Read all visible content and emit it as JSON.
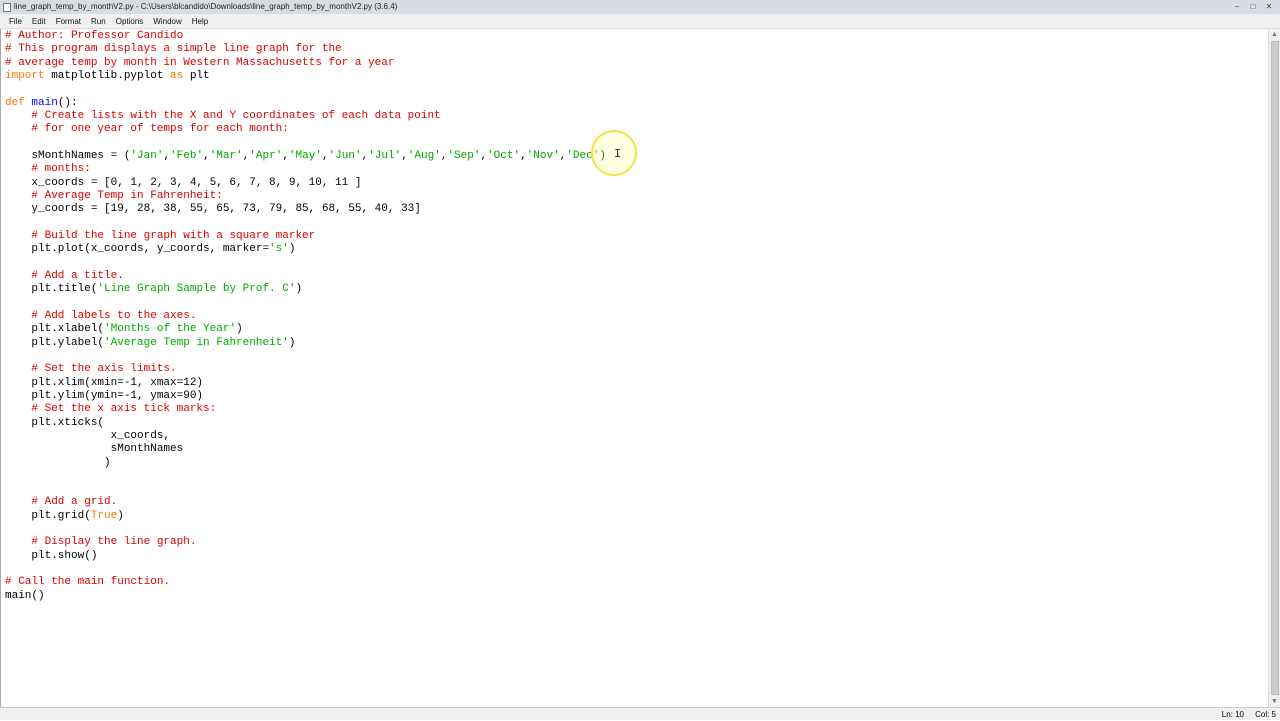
{
  "window": {
    "title": "line_graph_temp_by_monthV2.py - C:\\Users\\blcandido\\Downloads\\line_graph_temp_by_monthV2.py (3.6.4)",
    "minimize": "–",
    "maximize": "□",
    "close": "✕"
  },
  "menu": [
    "File",
    "Edit",
    "Format",
    "Run",
    "Options",
    "Window",
    "Help"
  ],
  "status": {
    "line": "Ln: 10",
    "col": "Col: 5"
  },
  "code": [
    [
      [
        "comment",
        "# Author: Professor Candido"
      ]
    ],
    [
      [
        "comment",
        "# This program displays a simple line graph for the"
      ]
    ],
    [
      [
        "comment",
        "# average temp by month in Western Massachusetts for a year"
      ]
    ],
    [
      [
        "keyword",
        "import"
      ],
      [
        "plain",
        " matplotlib.pyplot "
      ],
      [
        "keyword",
        "as"
      ],
      [
        "plain",
        " plt"
      ]
    ],
    [],
    [
      [
        "keyword",
        "def"
      ],
      [
        "plain",
        " "
      ],
      [
        "defname",
        "main"
      ],
      [
        "plain",
        "():"
      ]
    ],
    [
      [
        "plain",
        "    "
      ],
      [
        "comment",
        "# Create lists with the X and Y coordinates of each data point"
      ]
    ],
    [
      [
        "plain",
        "    "
      ],
      [
        "comment",
        "# for one year of temps for each month:"
      ]
    ],
    [],
    [
      [
        "plain",
        "    sMonthNames = ("
      ],
      [
        "string",
        "'Jan'"
      ],
      [
        "plain",
        ","
      ],
      [
        "string",
        "'Feb'"
      ],
      [
        "plain",
        ","
      ],
      [
        "string",
        "'Mar'"
      ],
      [
        "plain",
        ","
      ],
      [
        "string",
        "'Apr'"
      ],
      [
        "plain",
        ","
      ],
      [
        "string",
        "'May'"
      ],
      [
        "plain",
        ","
      ],
      [
        "string",
        "'Jun'"
      ],
      [
        "plain",
        ","
      ],
      [
        "string",
        "'Jul'"
      ],
      [
        "plain",
        ","
      ],
      [
        "string",
        "'Aug'"
      ],
      [
        "plain",
        ","
      ],
      [
        "string",
        "'Sep'"
      ],
      [
        "plain",
        ","
      ],
      [
        "string",
        "'Oct'"
      ],
      [
        "plain",
        ","
      ],
      [
        "string",
        "'Nov'"
      ],
      [
        "plain",
        ","
      ],
      [
        "string",
        "'Dec'"
      ],
      [
        "plain",
        ")"
      ]
    ],
    [
      [
        "plain",
        "    "
      ],
      [
        "comment",
        "# months:"
      ]
    ],
    [
      [
        "plain",
        "    x_coords = [0, 1, 2, 3, 4, 5, 6, 7, 8, 9, 10, 11 ]"
      ]
    ],
    [
      [
        "plain",
        "    "
      ],
      [
        "comment",
        "# Average Temp in Fahrenheit:"
      ]
    ],
    [
      [
        "plain",
        "    y_coords = [19, 28, 38, 55, 65, 73, 79, 85, 68, 55, 40, 33]"
      ]
    ],
    [],
    [
      [
        "plain",
        "    "
      ],
      [
        "comment",
        "# Build the line graph with a square marker"
      ]
    ],
    [
      [
        "plain",
        "    plt.plot(x_coords, y_coords, marker="
      ],
      [
        "string",
        "'s'"
      ],
      [
        "plain",
        ")"
      ]
    ],
    [],
    [
      [
        "plain",
        "    "
      ],
      [
        "comment",
        "# Add a title."
      ]
    ],
    [
      [
        "plain",
        "    plt.title("
      ],
      [
        "string",
        "'Line Graph Sample by Prof. C'"
      ],
      [
        "plain",
        ")"
      ]
    ],
    [],
    [
      [
        "plain",
        "    "
      ],
      [
        "comment",
        "# Add labels to the axes."
      ]
    ],
    [
      [
        "plain",
        "    plt.xlabel("
      ],
      [
        "string",
        "'Months of the Year'"
      ],
      [
        "plain",
        ")"
      ]
    ],
    [
      [
        "plain",
        "    plt.ylabel("
      ],
      [
        "string",
        "'Average Temp in Fahrenheit'"
      ],
      [
        "plain",
        ")"
      ]
    ],
    [],
    [
      [
        "plain",
        "    "
      ],
      [
        "comment",
        "# Set the axis limits."
      ]
    ],
    [
      [
        "plain",
        "    plt.xlim(xmin=-1, xmax=12)"
      ]
    ],
    [
      [
        "plain",
        "    plt.ylim(ymin=-1, ymax=90)"
      ]
    ],
    [
      [
        "plain",
        "    "
      ],
      [
        "comment",
        "# Set the x axis tick marks:"
      ]
    ],
    [
      [
        "plain",
        "    plt.xticks("
      ]
    ],
    [
      [
        "plain",
        "                x_coords,"
      ]
    ],
    [
      [
        "plain",
        "                sMonthNames"
      ]
    ],
    [
      [
        "plain",
        "               )"
      ]
    ],
    [],
    [],
    [
      [
        "plain",
        "    "
      ],
      [
        "comment",
        "# Add a grid."
      ]
    ],
    [
      [
        "plain",
        "    plt.grid("
      ],
      [
        "keyword",
        "True"
      ],
      [
        "plain",
        ")"
      ]
    ],
    [],
    [
      [
        "plain",
        "    "
      ],
      [
        "comment",
        "# Display the line graph."
      ]
    ],
    [
      [
        "plain",
        "    plt.show()"
      ]
    ],
    [],
    [
      [
        "comment",
        "# Call the main function."
      ]
    ],
    [
      [
        "plain",
        "main()"
      ]
    ]
  ]
}
